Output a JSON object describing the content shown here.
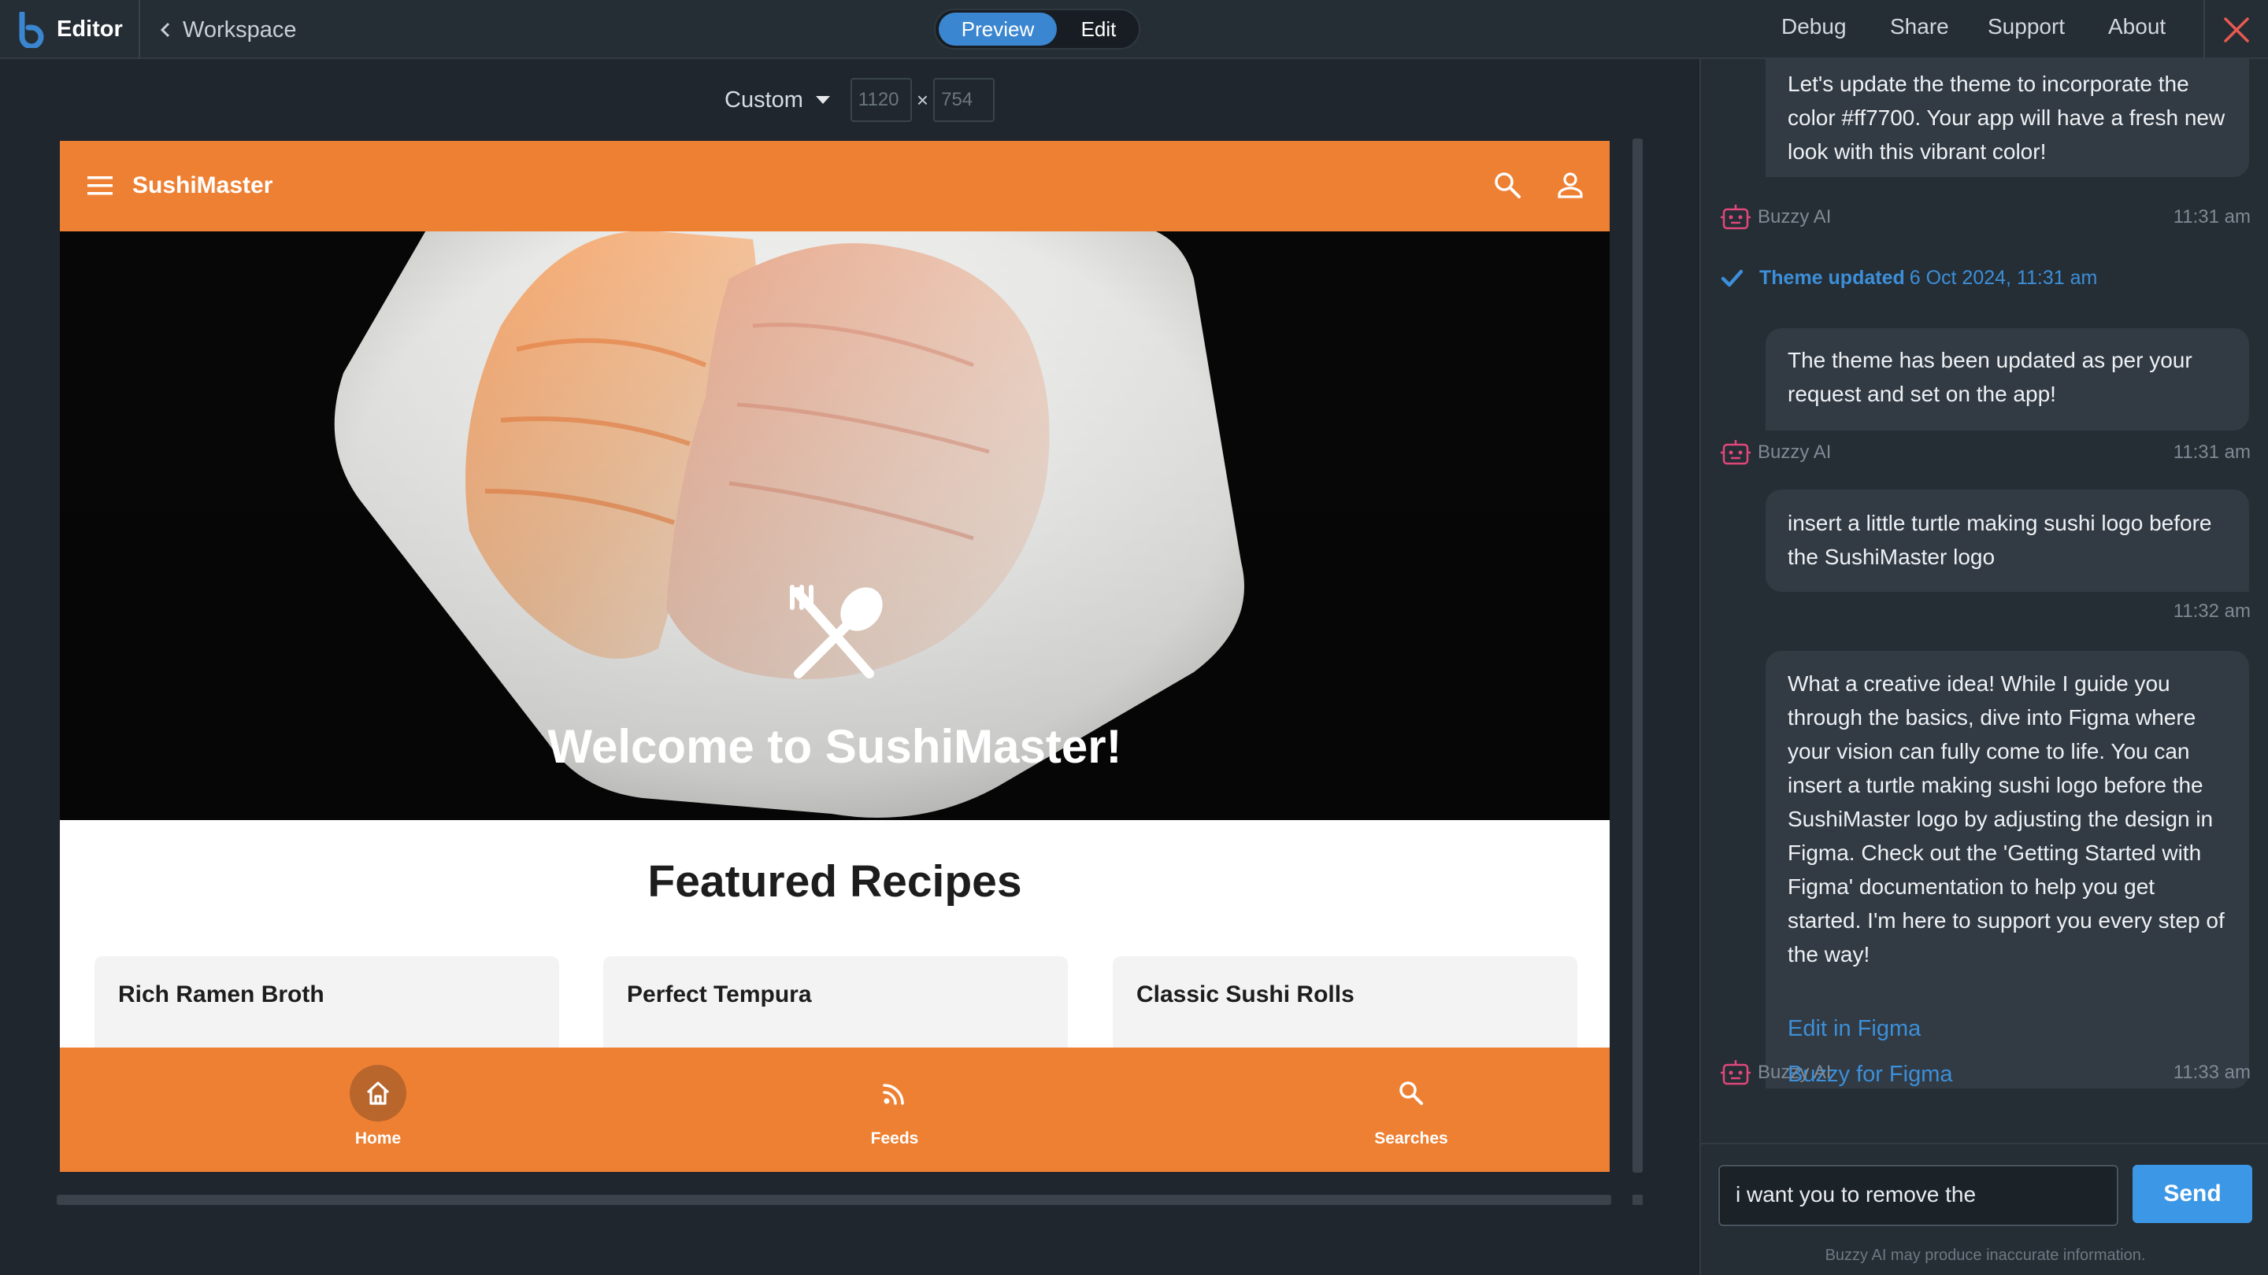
{
  "topbar": {
    "brand_title": "Editor",
    "back_label": "Workspace",
    "mode_preview": "Preview",
    "mode_edit": "Edit",
    "nav": [
      "Debug",
      "Share",
      "Support",
      "About"
    ],
    "close_icon": "close-icon",
    "accent_color": "#3a86d0",
    "close_color": "#e85a4f"
  },
  "device_bar": {
    "device_label": "Custom",
    "width_value": "1120",
    "height_value": "754",
    "separator": "×"
  },
  "app_preview": {
    "app_title": "SushiMaster",
    "theme_color": "#ee8033",
    "hero_title": "Welcome to SushiMaster!",
    "section_title": "Featured Recipes",
    "recipes": [
      "Rich Ramen Broth",
      "Perfect Tempura",
      "Classic Sushi Rolls"
    ],
    "bottom_nav": [
      {
        "label": "Home",
        "icon": "home-icon"
      },
      {
        "label": "Feeds",
        "icon": "rss-icon"
      },
      {
        "label": "Searches",
        "icon": "search-icon"
      }
    ]
  },
  "chat": {
    "messages": [
      {
        "role": "ai",
        "text": "Let's update the theme to incorporate the color #ff7700. Your app will have a fresh new look with this vibrant color!",
        "sender": "Buzzy AI",
        "time": "11:31 am"
      },
      {
        "role": "ai",
        "text": "The theme has been updated as per your request and set on the app!",
        "sender": "Buzzy AI",
        "time": "11:31 am"
      },
      {
        "role": "user",
        "text": "insert a little turtle making sushi logo before the SushiMaster logo",
        "time": "11:32 am"
      },
      {
        "role": "ai",
        "text": "What a creative idea! While I guide you through the basics, dive into Figma where your vision can fully come to life. You can insert a turtle making sushi logo before the SushiMaster logo by adjusting the design in Figma. Check out the 'Getting Started with Figma' documentation to help you get started. I'm here to support you every step of the way!",
        "links": [
          "Edit in Figma",
          "Buzzy for Figma"
        ],
        "sender": "Buzzy AI",
        "time": "11:33 am"
      }
    ],
    "event": {
      "label": "Theme updated",
      "time": "6 Oct 2024, 11:31 am"
    },
    "input_value": "i want you to remove the",
    "send_label": "Send",
    "disclaimer": "Buzzy AI may produce inaccurate information.",
    "link_color": "#3c8fd8"
  }
}
